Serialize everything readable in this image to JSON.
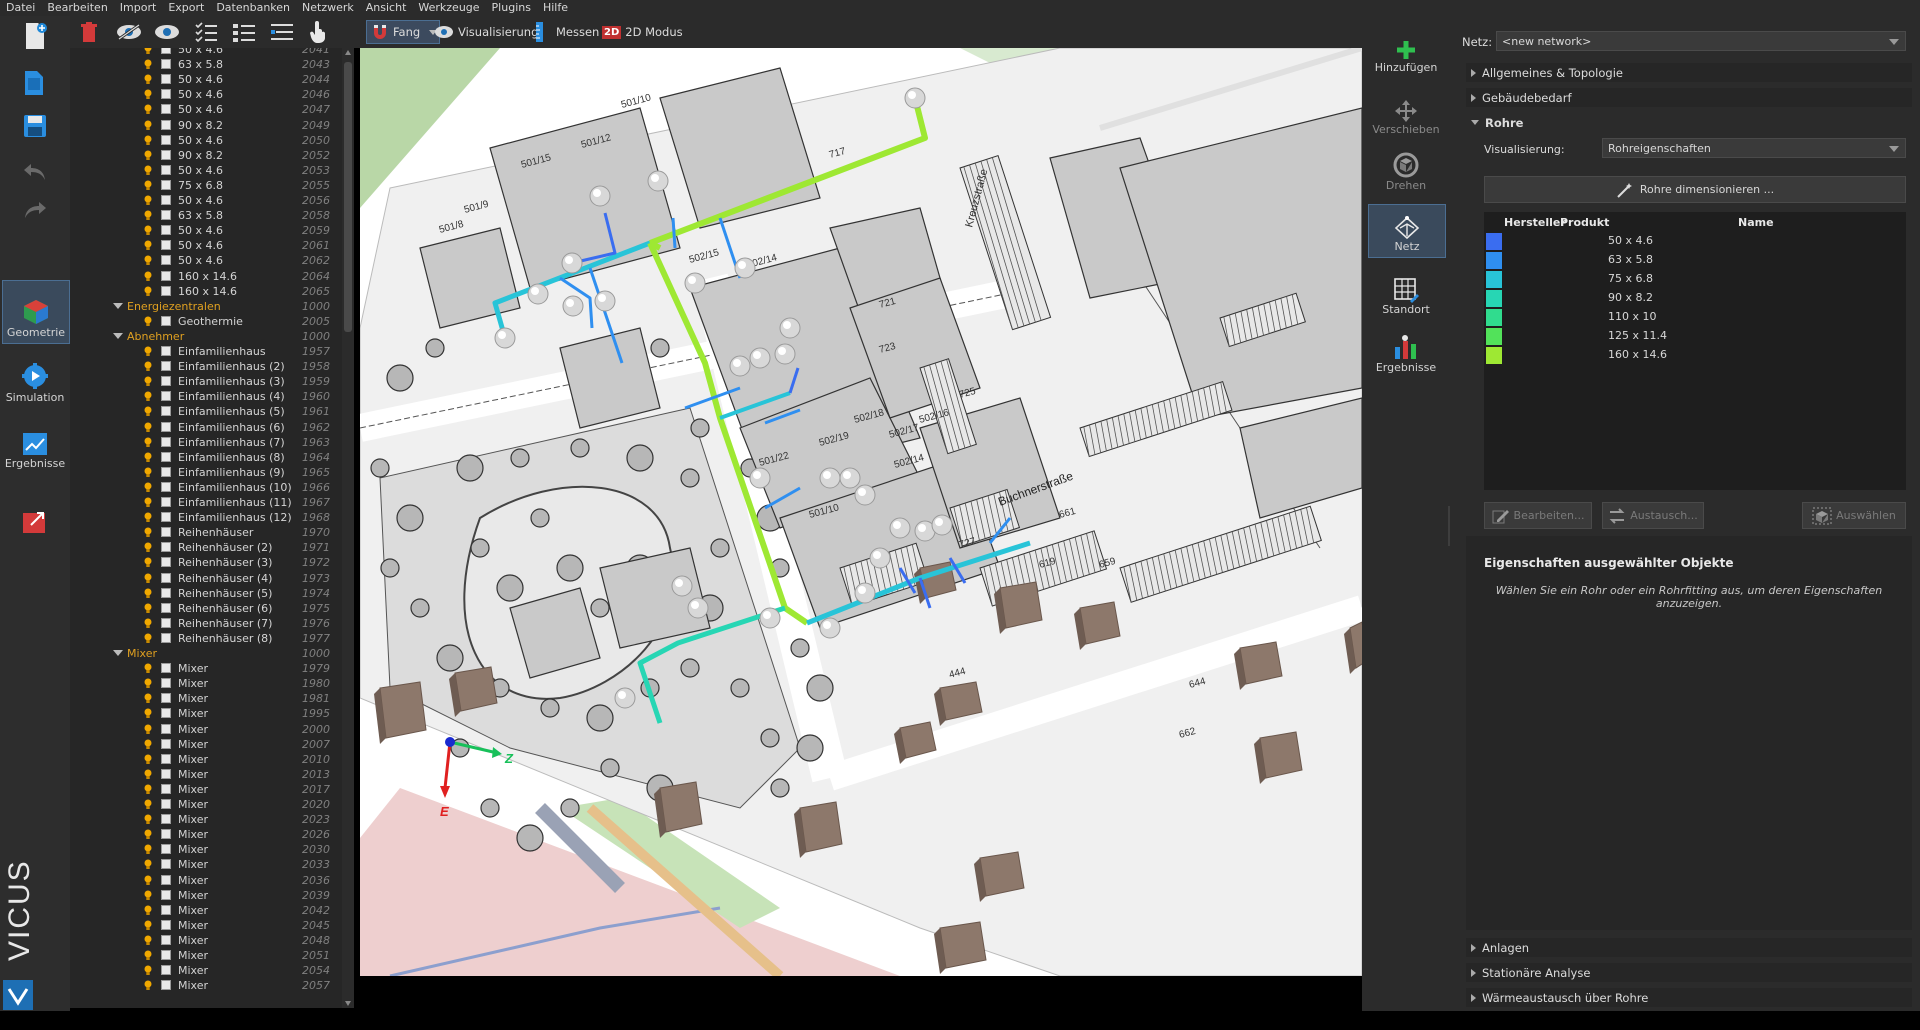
{
  "menu": [
    "Datei",
    "Bearbeiten",
    "Import",
    "Export",
    "Datenbanken",
    "Netzwerk",
    "Ansicht",
    "Werkzeuge",
    "Plugins",
    "Hilfe"
  ],
  "modes": [
    {
      "label": "Geometrie",
      "active": true
    },
    {
      "label": "Simulation",
      "active": false
    },
    {
      "label": "Ergebnisse",
      "active": false
    }
  ],
  "brand": "VICUS",
  "toolbar": {
    "fang": "Fang",
    "visualisierung": "Visualisierung",
    "messen": "Messen",
    "modus_badge": "2D",
    "modus": "2D Modus"
  },
  "tree": {
    "pipes": [
      {
        "name": "50 x 4.6",
        "id": "2041"
      },
      {
        "name": "63 x 5.8",
        "id": "2043"
      },
      {
        "name": "50 x 4.6",
        "id": "2044"
      },
      {
        "name": "50 x 4.6",
        "id": "2046"
      },
      {
        "name": "50 x 4.6",
        "id": "2047"
      },
      {
        "name": "90 x 8.2",
        "id": "2049"
      },
      {
        "name": "50 x 4.6",
        "id": "2050"
      },
      {
        "name": "90 x 8.2",
        "id": "2052"
      },
      {
        "name": "50 x 4.6",
        "id": "2053"
      },
      {
        "name": "75 x 6.8",
        "id": "2055"
      },
      {
        "name": "50 x 4.6",
        "id": "2056"
      },
      {
        "name": "63 x 5.8",
        "id": "2058"
      },
      {
        "name": "50 x 4.6",
        "id": "2059"
      },
      {
        "name": "50 x 4.6",
        "id": "2061"
      },
      {
        "name": "50 x 4.6",
        "id": "2062"
      },
      {
        "name": "160 x 14.6",
        "id": "2064"
      },
      {
        "name": "160 x 14.6",
        "id": "2065"
      }
    ],
    "group_energy": {
      "name": "Energiezentralen",
      "id": "1000"
    },
    "energy": [
      {
        "name": "Geothermie",
        "id": "2005"
      }
    ],
    "group_consumers": {
      "name": "Abnehmer",
      "id": "1000"
    },
    "consumers": [
      {
        "name": "Einfamilienhaus",
        "id": "1957"
      },
      {
        "name": "Einfamilienhaus (2)",
        "id": "1958"
      },
      {
        "name": "Einfamilienhaus (3)",
        "id": "1959"
      },
      {
        "name": "Einfamilienhaus (4)",
        "id": "1960"
      },
      {
        "name": "Einfamilienhaus (5)",
        "id": "1961"
      },
      {
        "name": "Einfamilienhaus (6)",
        "id": "1962"
      },
      {
        "name": "Einfamilienhaus (7)",
        "id": "1963"
      },
      {
        "name": "Einfamilienhaus (8)",
        "id": "1964"
      },
      {
        "name": "Einfamilienhaus (9)",
        "id": "1965"
      },
      {
        "name": "Einfamilienhaus (10)",
        "id": "1966"
      },
      {
        "name": "Einfamilienhaus (11)",
        "id": "1967"
      },
      {
        "name": "Einfamilienhaus (12)",
        "id": "1968"
      },
      {
        "name": "Reihenhäuser",
        "id": "1970"
      },
      {
        "name": "Reihenhäuser (2)",
        "id": "1971"
      },
      {
        "name": "Reihenhäuser (3)",
        "id": "1972"
      },
      {
        "name": "Reihenhäuser (4)",
        "id": "1973"
      },
      {
        "name": "Reihenhäuser (5)",
        "id": "1974"
      },
      {
        "name": "Reihenhäuser (6)",
        "id": "1975"
      },
      {
        "name": "Reihenhäuser (7)",
        "id": "1976"
      },
      {
        "name": "Reihenhäuser (8)",
        "id": "1977"
      }
    ],
    "group_mixer": {
      "name": "Mixer",
      "id": "1000"
    },
    "mixers": [
      {
        "name": "Mixer",
        "id": "1979"
      },
      {
        "name": "Mixer",
        "id": "1980"
      },
      {
        "name": "Mixer",
        "id": "1981"
      },
      {
        "name": "Mixer",
        "id": "1995"
      },
      {
        "name": "Mixer",
        "id": "2000"
      },
      {
        "name": "Mixer",
        "id": "2007"
      },
      {
        "name": "Mixer",
        "id": "2010"
      },
      {
        "name": "Mixer",
        "id": "2013"
      },
      {
        "name": "Mixer",
        "id": "2017"
      },
      {
        "name": "Mixer",
        "id": "2020"
      },
      {
        "name": "Mixer",
        "id": "2023"
      },
      {
        "name": "Mixer",
        "id": "2026"
      },
      {
        "name": "Mixer",
        "id": "2030"
      },
      {
        "name": "Mixer",
        "id": "2033"
      },
      {
        "name": "Mixer",
        "id": "2036"
      },
      {
        "name": "Mixer",
        "id": "2039"
      },
      {
        "name": "Mixer",
        "id": "2042"
      },
      {
        "name": "Mixer",
        "id": "2045"
      },
      {
        "name": "Mixer",
        "id": "2048"
      },
      {
        "name": "Mixer",
        "id": "2051"
      },
      {
        "name": "Mixer",
        "id": "2054"
      },
      {
        "name": "Mixer",
        "id": "2057"
      }
    ]
  },
  "viewport": {
    "plot_labels": [
      "501/12",
      "501/15",
      "501/10",
      "501/9",
      "501/8",
      "502/15",
      "502/14",
      "502/18",
      "502/19",
      "501/22",
      "501/10",
      "502/16",
      "502/17",
      "502/14",
      "717",
      "721",
      "723",
      "725",
      "727",
      "659",
      "661",
      "619",
      "444",
      "662",
      "644"
    ],
    "street_labels": [
      "Kreuzstraße",
      "Buchnerstraße"
    ],
    "axes": {
      "z": "Z",
      "e": "E"
    }
  },
  "netbar": [
    {
      "label": "Hinzufügen",
      "state": "normal"
    },
    {
      "label": "Verschieben",
      "state": "disabled"
    },
    {
      "label": "Drehen",
      "state": "disabled"
    },
    {
      "label": "Netz",
      "state": "active"
    },
    {
      "label": "Standort",
      "state": "normal"
    },
    {
      "label": "Ergebnisse",
      "state": "normal"
    }
  ],
  "props": {
    "netz_label": "Netz:",
    "netz_value": "<new network>",
    "sections_top": [
      "Allgemeines & Topologie",
      "Gebäudebedarf"
    ],
    "rohre_title": "Rohre",
    "vis_label": "Visualisierung:",
    "vis_value": "Rohreigenschaften",
    "dimension_button": "Rohre dimensionieren ...",
    "columns": [
      "Hersteller",
      "Produkt",
      "Name"
    ],
    "pipe_rows": [
      {
        "name": "50 x 4.6",
        "color": "#3a6df0"
      },
      {
        "name": "63 x 5.8",
        "color": "#2f8ff0"
      },
      {
        "name": "75 x 6.8",
        "color": "#28c4d8"
      },
      {
        "name": "90 x 8.2",
        "color": "#27d6b4"
      },
      {
        "name": "110 x 10",
        "color": "#30dc8e"
      },
      {
        "name": "125 x 11.4",
        "color": "#52e25a"
      },
      {
        "name": "160 x 14.6",
        "color": "#9ee833"
      }
    ],
    "btn_edit": "Bearbeiten...",
    "btn_exchange": "Austausch...",
    "btn_select": "Auswählen",
    "selected_title": "Eigenschaften ausgewählter Objekte",
    "selected_hint": "Wählen Sie ein Rohr oder ein Rohrfitting aus, um deren Eigenschaften anzuzeigen.",
    "sections_bottom": [
      "Anlagen",
      "Stationäre Analyse",
      "Wärmeaustausch über Rohre"
    ]
  }
}
